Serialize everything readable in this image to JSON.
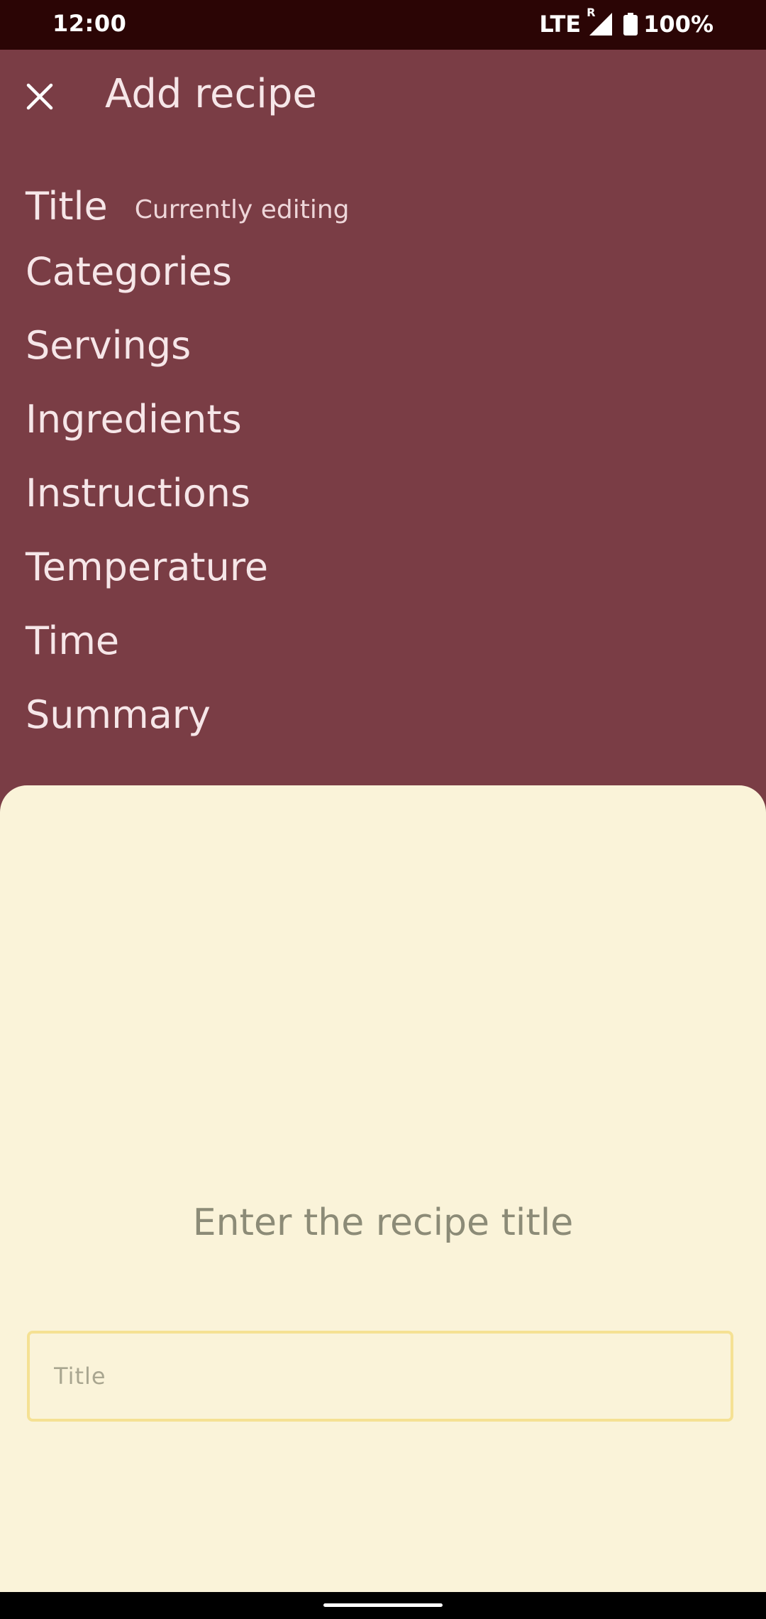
{
  "status_bar": {
    "time": "12:00",
    "network": "LTE",
    "roaming": "R",
    "battery": "100%",
    "icons": [
      "signal-icon",
      "battery-icon"
    ]
  },
  "app_bar": {
    "title": "Add recipe",
    "close_icon": "close-icon"
  },
  "steps": [
    {
      "label": "Title",
      "status": "Currently editing"
    },
    {
      "label": "Categories"
    },
    {
      "label": "Servings"
    },
    {
      "label": "Ingredients"
    },
    {
      "label": "Instructions"
    },
    {
      "label": "Temperature"
    },
    {
      "label": "Time"
    },
    {
      "label": "Summary"
    }
  ],
  "sheet": {
    "prompt": "Enter the recipe title",
    "title_input": {
      "placeholder": "Title",
      "value": ""
    }
  },
  "colors": {
    "status_bar_bg": "#2b0505",
    "app_bg": "#7a3d45",
    "sheet_bg": "#faf3d9",
    "input_border": "#f5e193",
    "prompt_text": "#8c8b77"
  }
}
